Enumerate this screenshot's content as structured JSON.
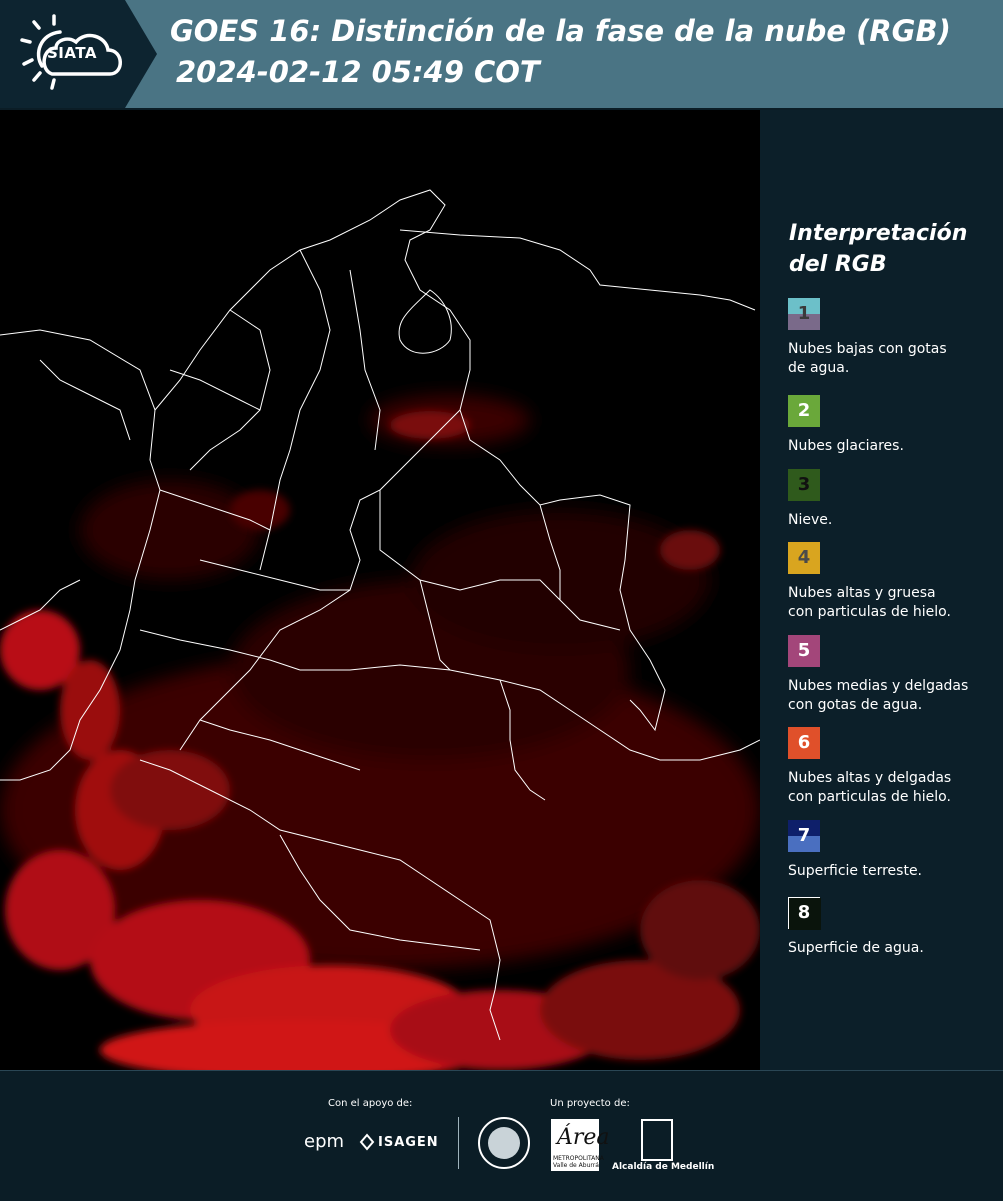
{
  "header": {
    "logo_text": "SIATA",
    "title": "GOES 16: Distinción de la fase de la nube (RGB)",
    "subtitle": "2024-02-12 05:49 COT"
  },
  "legend": {
    "title_line1": "Interpretación",
    "title_line2": "del RGB",
    "items": [
      {
        "number": "1",
        "top_color": "#6cc0c9",
        "bottom_color": "#7a6a8a",
        "number_color": "#3a3a3a",
        "description_line1": "Nubes bajas con gotas",
        "description_line2": "de agua."
      },
      {
        "number": "2",
        "top_color": "#6aa83a",
        "bottom_color": "#6aa83a",
        "number_color": "#ffffff",
        "description_line1": "Nubes glaciares.",
        "description_line2": ""
      },
      {
        "number": "3",
        "top_color": "#2f5a1c",
        "bottom_color": "#2f5a1c",
        "number_color": "#111111",
        "description_line1": "Nieve.",
        "description_line2": ""
      },
      {
        "number": "4",
        "top_color": "#d9a51f",
        "bottom_color": "#d9a51f",
        "number_color": "#4a4a4a",
        "description_line1": "Nubes altas y gruesa",
        "description_line2": "con particulas de hielo."
      },
      {
        "number": "5",
        "top_color": "#a3467a",
        "bottom_color": "#a3467a",
        "number_color": "#ffffff",
        "description_line1": "Nubes medias y delgadas",
        "description_line2": "con gotas de agua."
      },
      {
        "number": "6",
        "top_color": "#e0502a",
        "bottom_color": "#e0502a",
        "number_color": "#ffffff",
        "description_line1": "Nubes altas y delgadas",
        "description_line2": "con particulas de hielo."
      },
      {
        "number": "7",
        "top_color": "#0e1f6a",
        "bottom_color": "#4a6fc0",
        "number_color": "#ffffff",
        "description_line1": "Superficie terreste.",
        "description_line2": ""
      },
      {
        "number": "8",
        "top_color": "#0a140c",
        "bottom_color": "#0a140c",
        "number_color": "#ffffff",
        "description_line1": "Superficie de agua.",
        "description_line2": ""
      }
    ]
  },
  "footer": {
    "support_label": "Con el apoyo de:",
    "project_label": "Un proyecto de:",
    "epm": "epm",
    "isagen": "ISAGEN",
    "area_letter": "Área",
    "area_sub1": "METROPOLITANA",
    "area_sub2": "Valle de Aburrá",
    "alcaldia": "Alcaldía de Medellín"
  },
  "colors": {
    "header_bg": "#4a7484",
    "page_bg": "#0b1d26",
    "cloud_red": "#e0141a"
  }
}
